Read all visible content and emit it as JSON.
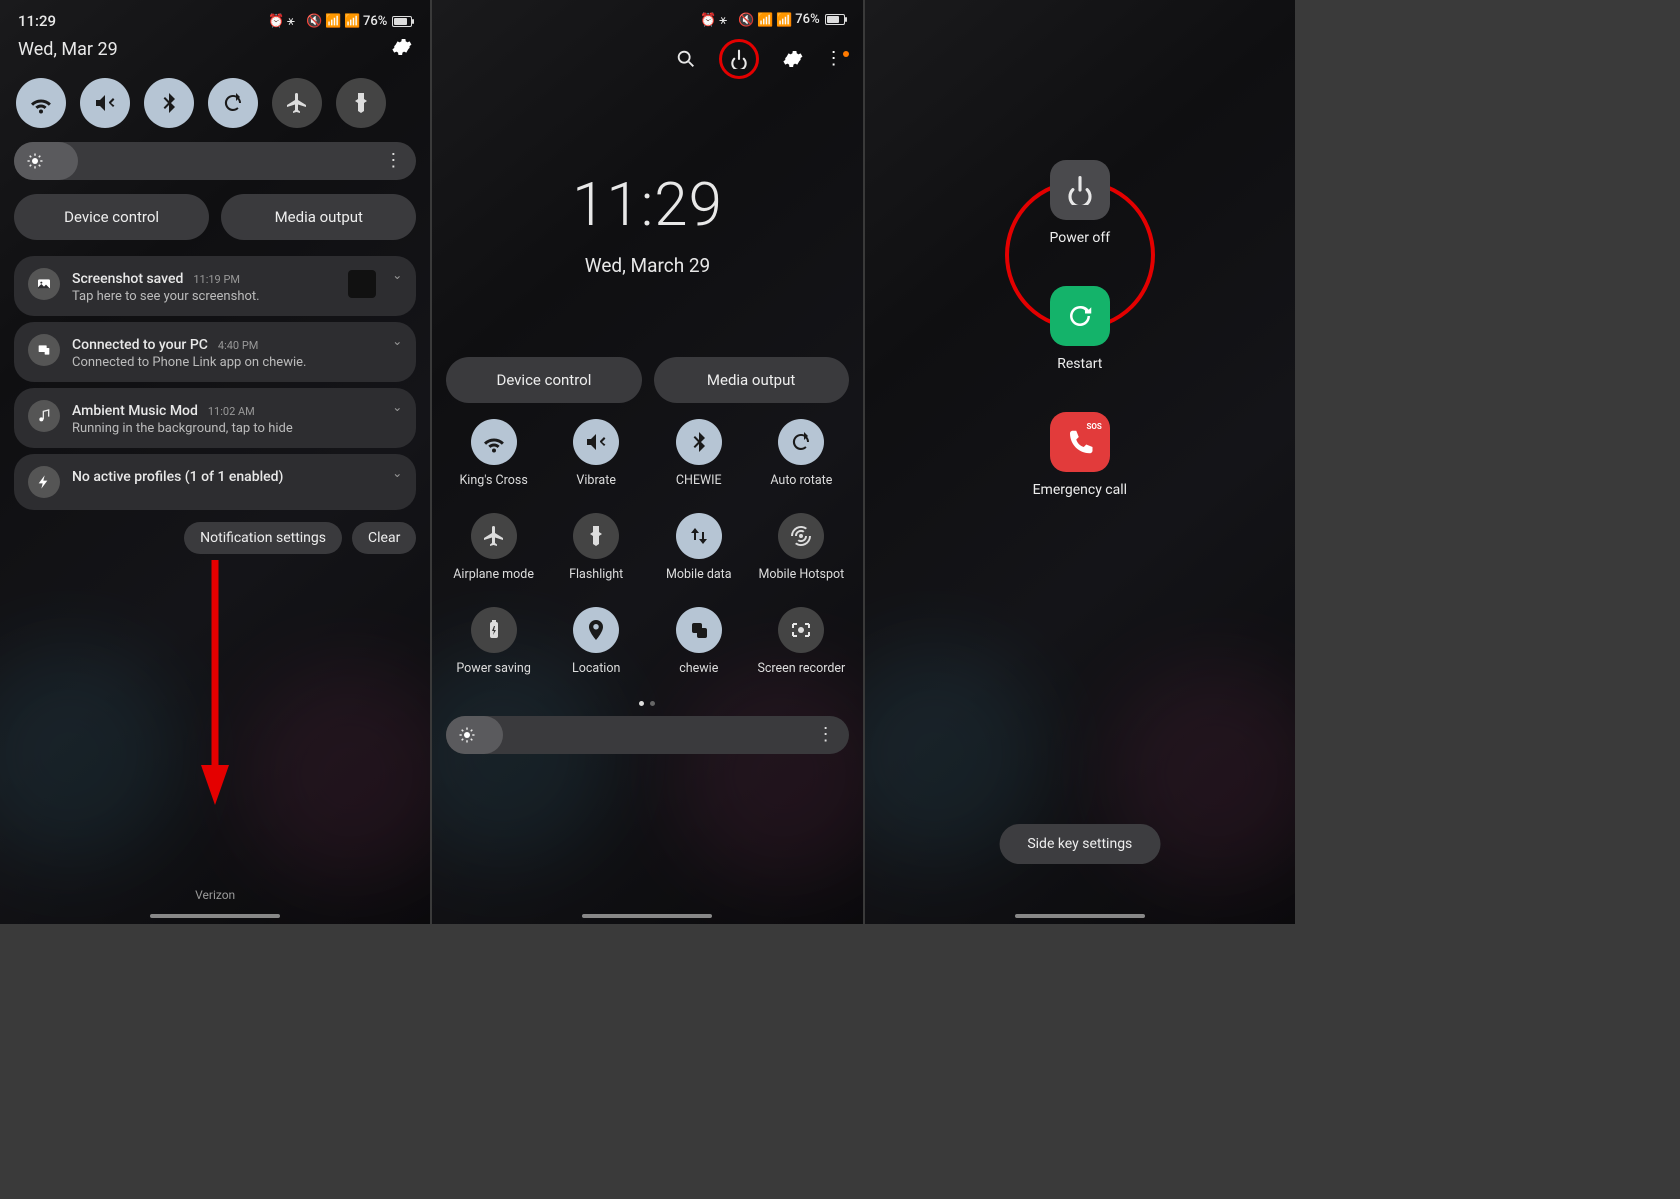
{
  "status": {
    "time": "11:29",
    "battery_pct": "76%",
    "icons": [
      "alarm",
      "bluetooth",
      "mute",
      "wifi",
      "signal"
    ]
  },
  "panel1": {
    "date": "Wed, Mar 29",
    "quick_toggles": [
      {
        "name": "wifi",
        "on": true
      },
      {
        "name": "mute",
        "on": true
      },
      {
        "name": "bluetooth",
        "on": true
      },
      {
        "name": "autorotate",
        "on": true
      },
      {
        "name": "airplane",
        "on": false
      },
      {
        "name": "flashlight",
        "on": false
      }
    ],
    "device_control": "Device control",
    "media_output": "Media output",
    "notifications": [
      {
        "icon": "image",
        "title": "Screenshot saved",
        "time": "11:19 PM",
        "body": "Tap here to see your screenshot.",
        "thumb": true
      },
      {
        "icon": "pc",
        "title": "Connected to your PC",
        "time": "4:40 PM",
        "body": "Connected to Phone Link app on chewie."
      },
      {
        "icon": "music",
        "title": "Ambient Music Mod",
        "time": "11:02 AM",
        "body": "Running in the background, tap to hide"
      },
      {
        "icon": "bolt",
        "title": "No active profiles (1 of 1 enabled)",
        "time": "",
        "body": ""
      }
    ],
    "notif_settings": "Notification settings",
    "clear": "Clear",
    "carrier": "Verizon"
  },
  "panel2": {
    "clock": "11:29",
    "date": "Wed, March 29",
    "device_control": "Device control",
    "media_output": "Media output",
    "tiles": [
      {
        "name": "wifi",
        "label": "King's Cross",
        "on": true
      },
      {
        "name": "vibrate",
        "label": "Vibrate",
        "on": true
      },
      {
        "name": "bluetooth",
        "label": "CHEWIE",
        "on": true
      },
      {
        "name": "autorotate",
        "label": "Auto rotate",
        "on": true
      },
      {
        "name": "airplane",
        "label": "Airplane mode",
        "on": false
      },
      {
        "name": "flashlight",
        "label": "Flashlight",
        "on": false
      },
      {
        "name": "mobiledata",
        "label": "Mobile data",
        "on": true
      },
      {
        "name": "hotspot",
        "label": "Mobile Hotspot",
        "on": false
      },
      {
        "name": "powersaving",
        "label": "Power saving",
        "on": false
      },
      {
        "name": "location",
        "label": "Location",
        "on": true
      },
      {
        "name": "link",
        "label": "chewie",
        "on": true
      },
      {
        "name": "screenrecorder",
        "label": "Screen recorder",
        "on": false
      }
    ]
  },
  "panel3": {
    "power_off": "Power off",
    "restart": "Restart",
    "emergency": "Emergency call",
    "side_key": "Side key settings"
  }
}
